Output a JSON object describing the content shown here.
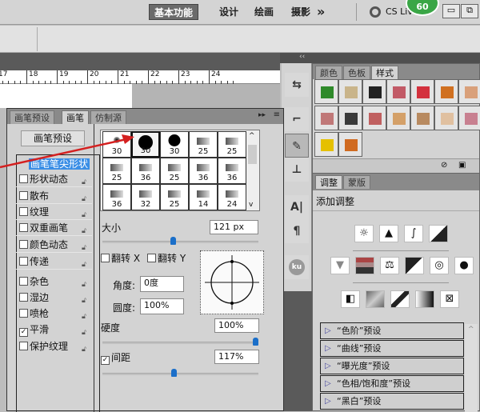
{
  "topbar": {
    "workspaces": [
      "基本功能",
      "设计",
      "绘画",
      "摄影"
    ],
    "more": "»",
    "cs_live": "CS Live",
    "badge": "60",
    "minimize": "▭",
    "restore": "⧉"
  },
  "ruler": {
    "ticks": [
      "17",
      "18",
      "19",
      "20",
      "21",
      "22",
      "23",
      "24"
    ]
  },
  "dock": {
    "collapse": "‹‹"
  },
  "styles_panel": {
    "tabs": [
      "颜色",
      "色板",
      "样式"
    ],
    "active_tab": "样式",
    "swatches": [
      "#2f8a2a",
      "#c9b48a",
      "#222",
      "#c25a66",
      "#d3313d",
      "#d07020",
      "#d9a07a",
      "#c07878",
      "#3a3a3a",
      "#c06060",
      "#d4a068",
      "#b88a60",
      "#e0c0a0",
      "#c88090",
      "#e5c000",
      "#d06a20"
    ]
  },
  "adjust_panel": {
    "tabs": [
      "调整",
      "蒙版"
    ],
    "active_tab": "调整",
    "title": "添加调整",
    "presets": [
      "“色阶”预设",
      "“曲线”预设",
      "“曝光度”预设",
      "“色相/饱和度”预设",
      "“黑白”预设"
    ]
  },
  "brush_panel": {
    "tabs": [
      "画笔预设",
      "画笔",
      "仿制源"
    ],
    "active_tab": "画笔",
    "presets_button": "画笔预设",
    "options": [
      {
        "label": "画笔笔尖形状",
        "checked": null,
        "selected": true
      },
      {
        "label": "形状动态",
        "checked": false
      },
      {
        "label": "散布",
        "checked": false
      },
      {
        "label": "纹理",
        "checked": false
      },
      {
        "label": "双重画笔",
        "checked": false
      },
      {
        "label": "颜色动态",
        "checked": false
      },
      {
        "label": "传递",
        "checked": false
      },
      {
        "label": "杂色",
        "checked": false
      },
      {
        "label": "湿边",
        "checked": false
      },
      {
        "label": "喷枪",
        "checked": false
      },
      {
        "label": "平滑",
        "checked": true
      },
      {
        "label": "保护纹理",
        "checked": false
      }
    ],
    "brush_sizes": [
      "30",
      "30",
      "30",
      "25",
      "25",
      "25",
      "36",
      "25",
      "36",
      "36",
      "36",
      "32",
      "25",
      "14",
      "24"
    ],
    "selected_brush": 1,
    "size_label": "大小",
    "size_value": "121 px",
    "size_fraction": 0.45,
    "flip_x": "翻转 X",
    "flip_y": "翻转 Y",
    "angle_label": "角度:",
    "angle_value": "0度",
    "roundness_label": "圆度:",
    "roundness_value": "100%",
    "hardness_label": "硬度",
    "hardness_value": "100%",
    "hardness_fraction": 1.0,
    "spacing_label": "间距",
    "spacing_checked": true,
    "spacing_value": "117%",
    "spacing_fraction": 0.46
  },
  "colors": {
    "accent": "#1b6fc9",
    "arrow": "#d42020",
    "selection": "#3a8ee6"
  }
}
